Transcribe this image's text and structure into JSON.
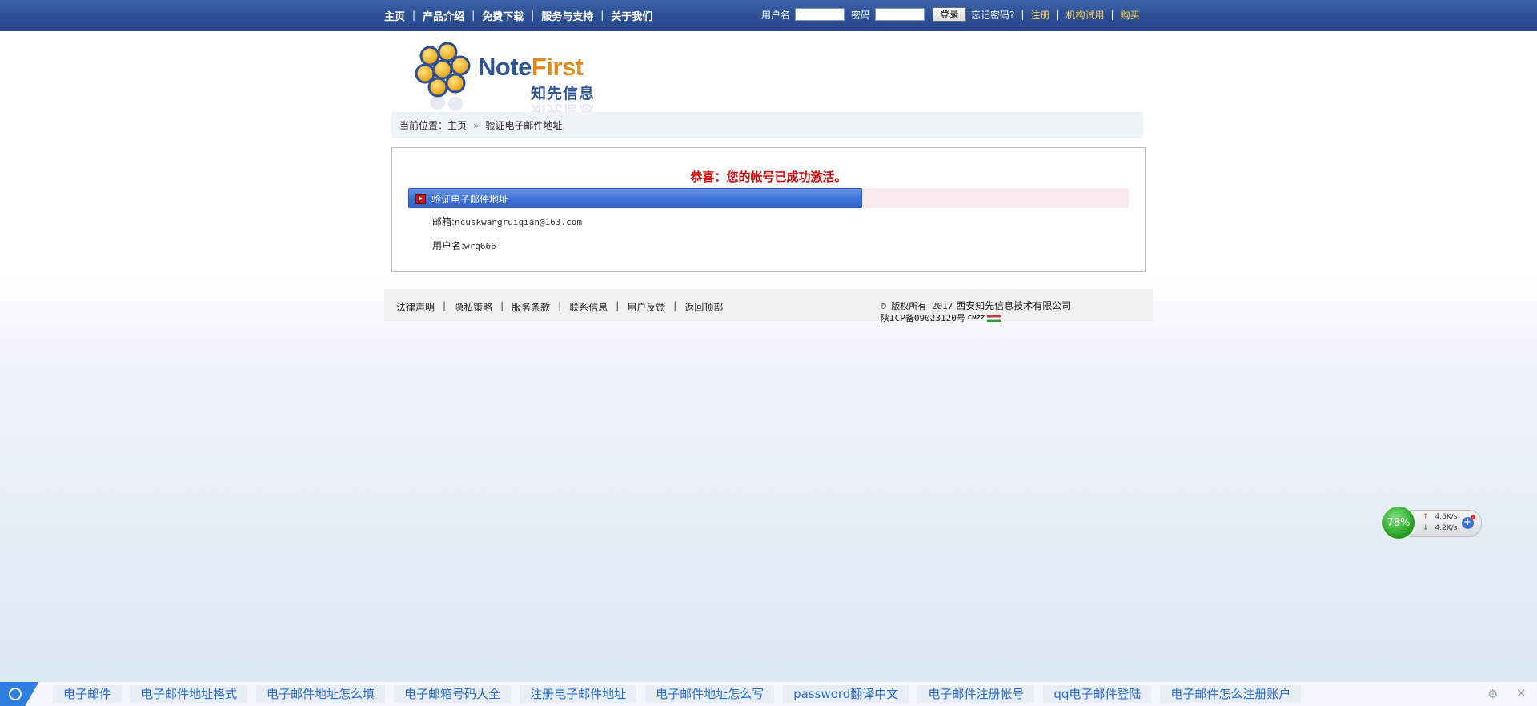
{
  "nav": {
    "items": [
      "主页",
      "产品介绍",
      "免费下载",
      "服务与支持",
      "关于我们"
    ]
  },
  "login": {
    "username_label": "用户名",
    "password_label": "密码",
    "login_button": "登录",
    "forgot": "忘记密码?",
    "register": "注册",
    "trial": "机构试用",
    "buy": "购买"
  },
  "logo": {
    "en_note": "Note",
    "en_first": "First",
    "cn": "知先信息"
  },
  "breadcrumb": {
    "prefix": "当前位置：",
    "home": "主页",
    "sep": "»",
    "current": "验证电子邮件地址"
  },
  "content": {
    "success_message": "恭喜：您的帐号已成功激活。",
    "progress_label": "验证电子邮件地址",
    "progress_fraction": 0.63,
    "email_label": "邮箱:",
    "email_value": "ncuskwangruiqian@163.com",
    "username_label": "用户名:",
    "username_value": "wrq666"
  },
  "footer": {
    "links": [
      "法律声明",
      "隐私策略",
      "服务条款",
      "联系信息",
      "用户反馈",
      "返回顶部"
    ],
    "copyright_prefix": "© 版权所有 2017",
    "company": "西安知先信息技术有限公司",
    "icp": "陕ICP备09023120号",
    "cnzz": "CNZZ"
  },
  "speed_widget": {
    "percent": "78%",
    "upload": "4.6K/s",
    "download": "4.2K/s"
  },
  "bottom_bar": {
    "chips": [
      "电子邮件",
      "电子邮件地址格式",
      "电子邮件地址怎么填",
      "电子邮箱号码大全",
      "注册电子邮件地址",
      "电子邮件地址怎么写",
      "password翻译中文",
      "电子邮件注册帐号",
      "qq电子邮件登陆",
      "电子邮件怎么注册账户"
    ]
  }
}
